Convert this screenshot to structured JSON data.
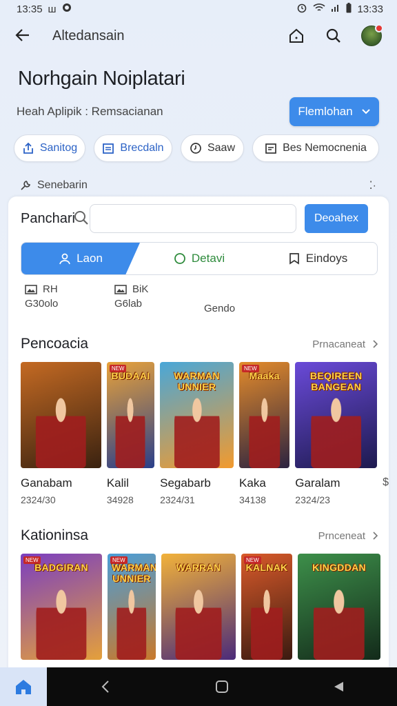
{
  "status": {
    "time_left": "13:35",
    "mini_text": "ш",
    "time_right": "13:33"
  },
  "app_bar": {
    "title": "Altedansain"
  },
  "header": {
    "title": "Norhgain Noiplatari",
    "subtitle": "Heah Aplipik : Remsacianan",
    "primary_button": "Flemlohan"
  },
  "chips": [
    {
      "label": "Sanitog",
      "icon": "share-icon"
    },
    {
      "label": "Brecdaln",
      "icon": "calendar-icon"
    },
    {
      "label": "Saaw",
      "icon": "clock-icon"
    },
    {
      "label": "Bes Nemocnenia",
      "icon": "calendar-icon"
    }
  ],
  "hint": {
    "label": "Senebarin",
    "right": "⁚·"
  },
  "search": {
    "label": "Panchari",
    "value": "",
    "placeholder": "",
    "button": "Deoahex"
  },
  "tabs": [
    {
      "label": "Laon",
      "icon": "user-icon"
    },
    {
      "label": "Detavi",
      "icon": "chat-icon"
    },
    {
      "label": "Eindoys",
      "icon": "bookmark-icon"
    }
  ],
  "info": [
    {
      "top": "RH",
      "bottom": "G30olo"
    },
    {
      "top": "BiK",
      "bottom": "G6lab"
    },
    {
      "top": "",
      "bottom": "Gendo"
    }
  ],
  "sections": [
    {
      "title": "Pencoacia",
      "more": "Prnacaneat",
      "games": [
        {
          "name": "Ganabam",
          "meta": "2324/30",
          "logo": "",
          "badge": "",
          "colors": [
            "#c46a23",
            "#3a2210"
          ]
        },
        {
          "name": "Kalil",
          "meta": "34928",
          "logo": "BUDAAI",
          "badge": "NEW",
          "colors": [
            "#e8a23a",
            "#2a3f8a"
          ]
        },
        {
          "name": "Segabarb",
          "meta": "2324/31",
          "logo": "WARMAN UNNIER",
          "badge": "",
          "colors": [
            "#49a7d8",
            "#f29a2e"
          ]
        },
        {
          "name": "Kaka",
          "meta": "34138",
          "logo": "Maaka",
          "badge": "NEW",
          "colors": [
            "#e38b2b",
            "#2c2340"
          ]
        },
        {
          "name": "Garalam",
          "meta": "2324/23",
          "logo": "BEQIREEN BANGEAN",
          "badge": "",
          "colors": [
            "#6a4ad8",
            "#1d1a4e"
          ]
        }
      ],
      "overflow": "$"
    },
    {
      "title": "Kationinsa",
      "more": "Prnceneat",
      "games": [
        {
          "name": "",
          "meta": "",
          "logo": "BADGIRAN",
          "badge": "NEW",
          "colors": [
            "#7b3fc0",
            "#e4a03b"
          ]
        },
        {
          "name": "",
          "meta": "",
          "logo": "WARMAN UNNIER",
          "badge": "NEW",
          "colors": [
            "#4a9ed8",
            "#c9792b"
          ]
        },
        {
          "name": "",
          "meta": "",
          "logo": "WARRAN",
          "badge": "",
          "colors": [
            "#f2b23a",
            "#4b2b7a"
          ]
        },
        {
          "name": "",
          "meta": "",
          "logo": "KALNAK",
          "badge": "NEW",
          "colors": [
            "#d85a2a",
            "#3a1a10"
          ]
        },
        {
          "name": "",
          "meta": "",
          "logo": "KINGDDAN",
          "badge": "",
          "colors": [
            "#3d8f4a",
            "#132a1a"
          ]
        }
      ]
    }
  ]
}
